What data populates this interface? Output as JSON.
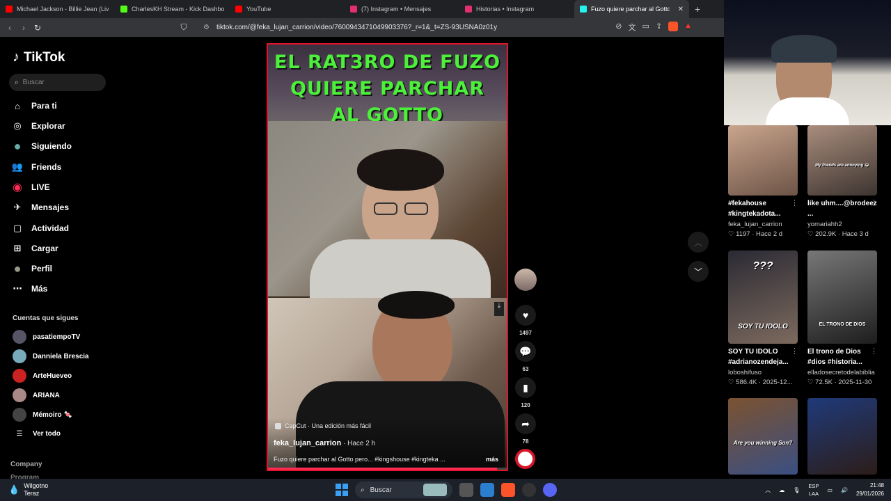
{
  "browser": {
    "tabs": [
      {
        "label": "Michael Jackson - Billie Jean (Live) -",
        "color": "#ff0000",
        "active": false
      },
      {
        "label": "CharlesKH Stream - Kick Dashboa",
        "color": "#53fc18",
        "active": false
      },
      {
        "label": "YouTube",
        "color": "#ff0000",
        "active": false
      },
      {
        "label": "(7) Instagram • Mensajes",
        "color": "#e1306c",
        "active": false
      },
      {
        "label": "Historias • Instagram",
        "color": "#e1306c",
        "active": false
      },
      {
        "label": "Fuzo quiere parchar al Gotto per",
        "color": "#25f4ee",
        "active": true
      }
    ],
    "url": "tiktok.com/@feka_lujan_carrion/video/7600943471049903376?_r=1&_t=ZS-93USNA0z01y"
  },
  "sidebar": {
    "logo_text": "TikTok",
    "search_placeholder": "Buscar",
    "nav": [
      {
        "label": "Para ti",
        "icon": "home-icon"
      },
      {
        "label": "Explorar",
        "icon": "compass-icon"
      },
      {
        "label": "Siguiendo",
        "icon": "following-avatar-icon"
      },
      {
        "label": "Friends",
        "icon": "friends-icon"
      },
      {
        "label": "LIVE",
        "icon": "live-icon"
      },
      {
        "label": "Mensajes",
        "icon": "messages-icon"
      },
      {
        "label": "Actividad",
        "icon": "activity-icon"
      },
      {
        "label": "Cargar",
        "icon": "upload-icon"
      },
      {
        "label": "Perfil",
        "icon": "profile-avatar-icon"
      },
      {
        "label": "Más",
        "icon": "more-icon"
      }
    ],
    "following_title": "Cuentas que sigues",
    "following": [
      {
        "name": "pasatiempoTV",
        "color": "#556"
      },
      {
        "name": "Danniela Brescia",
        "color": "#7ab"
      },
      {
        "name": "ArteHueveo",
        "color": "#c22"
      },
      {
        "name": "ARIANA",
        "color": "#a88"
      },
      {
        "name": "Mémoiro 🍬",
        "color": "#444"
      }
    ],
    "see_all": "Ver todo",
    "company": "Company",
    "program": "Program"
  },
  "video": {
    "title_lines": [
      "EL RAT3RO DE FUZO",
      "QUIERE PARCHAR",
      "AL GOTTO"
    ],
    "capcut": "CapCut · Una edición más fácil",
    "username": "feka_lujan_carrion",
    "time": " · Hace 2 h",
    "description": "Fuzo quiere parchar al Gotto pero... #kingshouse #kingteka ...",
    "more": "más",
    "progress": 0.96
  },
  "actions": {
    "likes": "1497",
    "comments": "63",
    "saves": "120",
    "shares": "78"
  },
  "recommendations": [
    {
      "title": "#fekahouse #kingtekadota...",
      "author": "feka_lujan_carrion",
      "stats": "♡ 1197 · Hace 2 d",
      "caption": "",
      "colors": [
        "#c9a58d",
        "#6d5447"
      ]
    },
    {
      "title": "like uhm....@brodeez ...",
      "author": "yomariahh2",
      "stats": "♡ 202.9K · Hace 3 d",
      "caption": "My friends are annoying 😂",
      "colors": [
        "#a98d7d",
        "#3d3430"
      ]
    },
    {
      "title": "SOY TU IDOLO #adrianozendeja...",
      "author": "loboshifuso",
      "stats": "♡ 586.4K · 2025-12...",
      "caption": "SOY TU IDOLO",
      "top_caption": "???",
      "colors": [
        "#2a2a34",
        "#7d6a5e"
      ]
    },
    {
      "title": "El trono de Dios #dios #historia...",
      "author": "elladosecretodelabiblia",
      "stats": "♡ 72.5K · 2025-11-30",
      "caption": "EL TRONO DE DIOS",
      "colors": [
        "#777",
        "#1e1e1e"
      ]
    },
    {
      "title": "",
      "author": "",
      "stats": "",
      "caption": "Are you winning Son?",
      "colors": [
        "#7b5230",
        "#3a4f82"
      ]
    },
    {
      "title": "",
      "author": "",
      "stats": "",
      "caption": "",
      "colors": [
        "#1f3a7a",
        "#2c1d18"
      ]
    }
  ],
  "taskbar": {
    "weather_temp": "Wilgotno",
    "weather_desc": "Teraz",
    "search": "Buscar",
    "lang_top": "ESP",
    "lang_bottom": "LAA",
    "time": "21:48",
    "date": "29/01/2026"
  }
}
